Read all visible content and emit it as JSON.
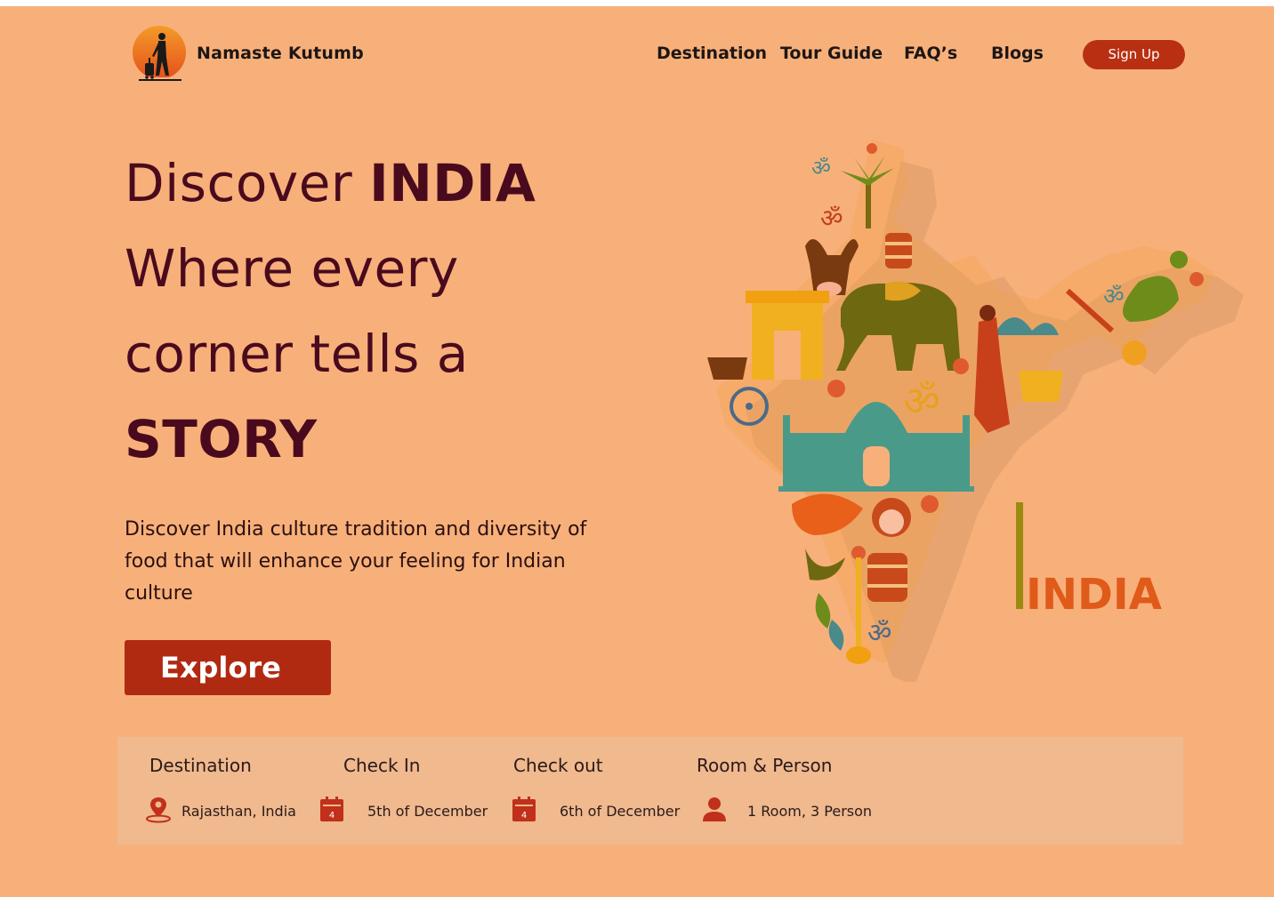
{
  "brand": {
    "name": "Namaste Kutumb",
    "logo_icon": "traveler-sunset-logo"
  },
  "nav": {
    "items": [
      "Destination",
      "Tour Guide",
      "FAQ’s",
      "Blogs"
    ],
    "signup_label": "Sign Up"
  },
  "hero": {
    "line1_regular": "Discover ",
    "line1_bold": "INDIA",
    "line2": "Where every",
    "line3": "corner tells a",
    "line4_bold": "STORY",
    "description": "Discover India culture tradition and diversity of food that will enhance your feeling for Indian culture",
    "explore_label": "Explore"
  },
  "illustration": {
    "map_label": "INDIA",
    "icon": "india-culture-map-illustration"
  },
  "booking": {
    "destination": {
      "label": "Destination",
      "value": "Rajasthan, India",
      "icon": "location-pin-icon"
    },
    "checkin": {
      "label": "Check In",
      "value": "5th of December",
      "icon": "calendar-icon",
      "day": "4"
    },
    "checkout": {
      "label": "Check out",
      "value": "6th of December",
      "icon": "calendar-icon",
      "day": "4"
    },
    "rooms": {
      "label": "Room & Person",
      "value": "1 Room, 3 Person",
      "icon": "person-icon"
    }
  },
  "colors": {
    "background": "#f8b07a",
    "accent": "#b02a12",
    "headline": "#4a0a1e",
    "booking_bar": "#f0b98e"
  }
}
